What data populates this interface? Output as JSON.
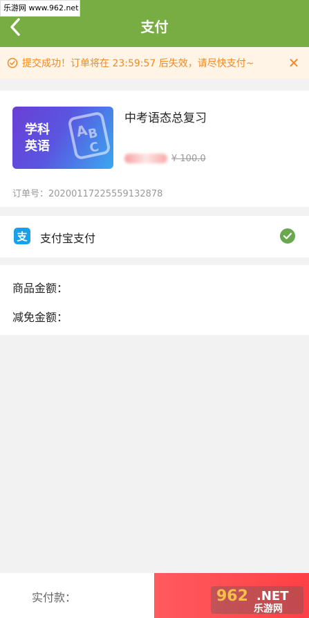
{
  "watermark_top": "乐游网 www.962.net",
  "header": {
    "title": "支付"
  },
  "notice": {
    "text": "提交成功！订单将在 23:59:57 后失效，请尽快支付~",
    "close": "✕"
  },
  "course": {
    "cover_text_line1": "学科",
    "cover_text_line2": "英语",
    "cover_letters": [
      "A",
      "B",
      "C"
    ],
    "title": "中考语态总复习",
    "old_price": "¥ 100.0",
    "order_label": "订单号：",
    "order_no": "20200117225559132878"
  },
  "payment": {
    "method": "支付宝支付",
    "icon": "支"
  },
  "amounts": {
    "goods_label": "商品金额：",
    "discount_label": "减免金额："
  },
  "footer": {
    "total_label": "实付款："
  },
  "watermark_bottom": {
    "num": "962",
    "net": ".NET",
    "cn": "乐游网"
  },
  "colors": {
    "header": "#78ad44",
    "notice": "#f08a24",
    "pay_button": "#ff4a50",
    "check": "#6aa84f",
    "alipay": "#1aa0e6"
  }
}
